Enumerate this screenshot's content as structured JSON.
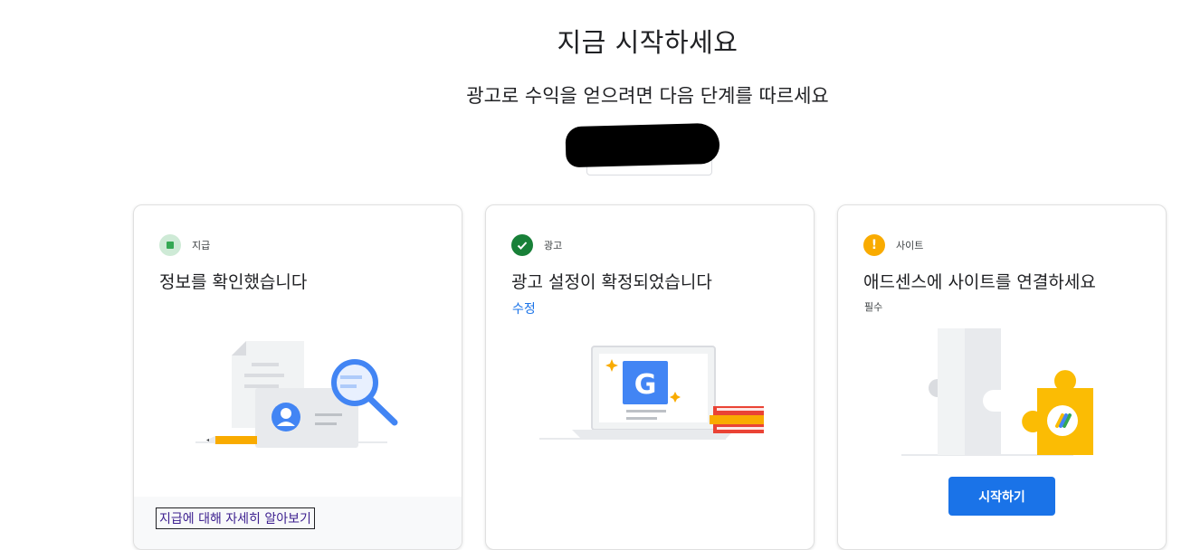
{
  "header": {
    "title": "지금 시작하세요",
    "subtitle": "광고로 수익을 얻으려면 다음 단계를 따르세요"
  },
  "cards": [
    {
      "category": "지급",
      "status": "done",
      "title": "정보를 확인했습니다",
      "footer_link": "지급에 대해 자세히 알아보기"
    },
    {
      "category": "광고",
      "status": "complete",
      "title": "광고 설정이 확정되었습니다",
      "action_link": "수정"
    },
    {
      "category": "사이트",
      "status": "attention",
      "status_glyph": "!",
      "title": "애드센스에 사이트를 연결하세요",
      "note": "필수",
      "button_label": "시작하기"
    }
  ],
  "illustration_letter": "G",
  "colors": {
    "primary_blue": "#1a73e8",
    "success_green": "#188038",
    "warning_yellow": "#f9ab00"
  }
}
